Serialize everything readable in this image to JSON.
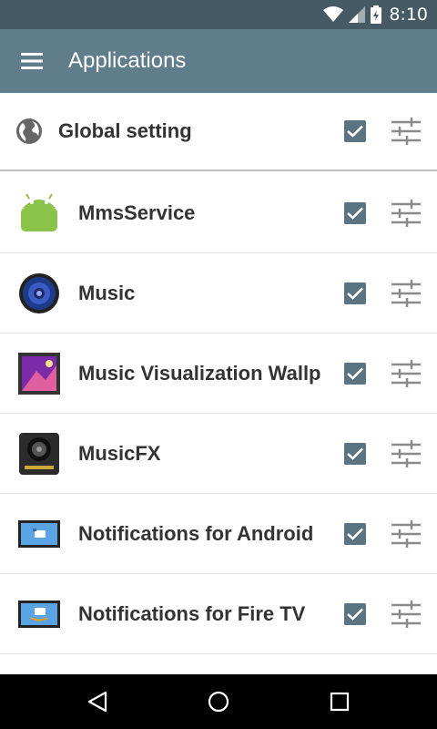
{
  "status_bar": {
    "time": "8:10"
  },
  "toolbar": {
    "title": "Applications"
  },
  "global": {
    "label": "Global setting",
    "checked": true
  },
  "apps": [
    {
      "label": "MmsService",
      "icon": "android-icon",
      "checked": true
    },
    {
      "label": "Music",
      "icon": "speaker-icon",
      "checked": true
    },
    {
      "label": "Music Visualization Wallp",
      "icon": "wallpaper-icon",
      "checked": true
    },
    {
      "label": "MusicFX",
      "icon": "musicfx-icon",
      "checked": true
    },
    {
      "label": "Notifications for Android",
      "icon": "notifications-android-icon",
      "checked": true
    },
    {
      "label": "Notifications for Fire TV",
      "icon": "notifications-firetv-icon",
      "checked": true
    }
  ],
  "colors": {
    "status_bar": "#455a64",
    "toolbar": "#607d8b",
    "checkbox": "#5b7481"
  }
}
